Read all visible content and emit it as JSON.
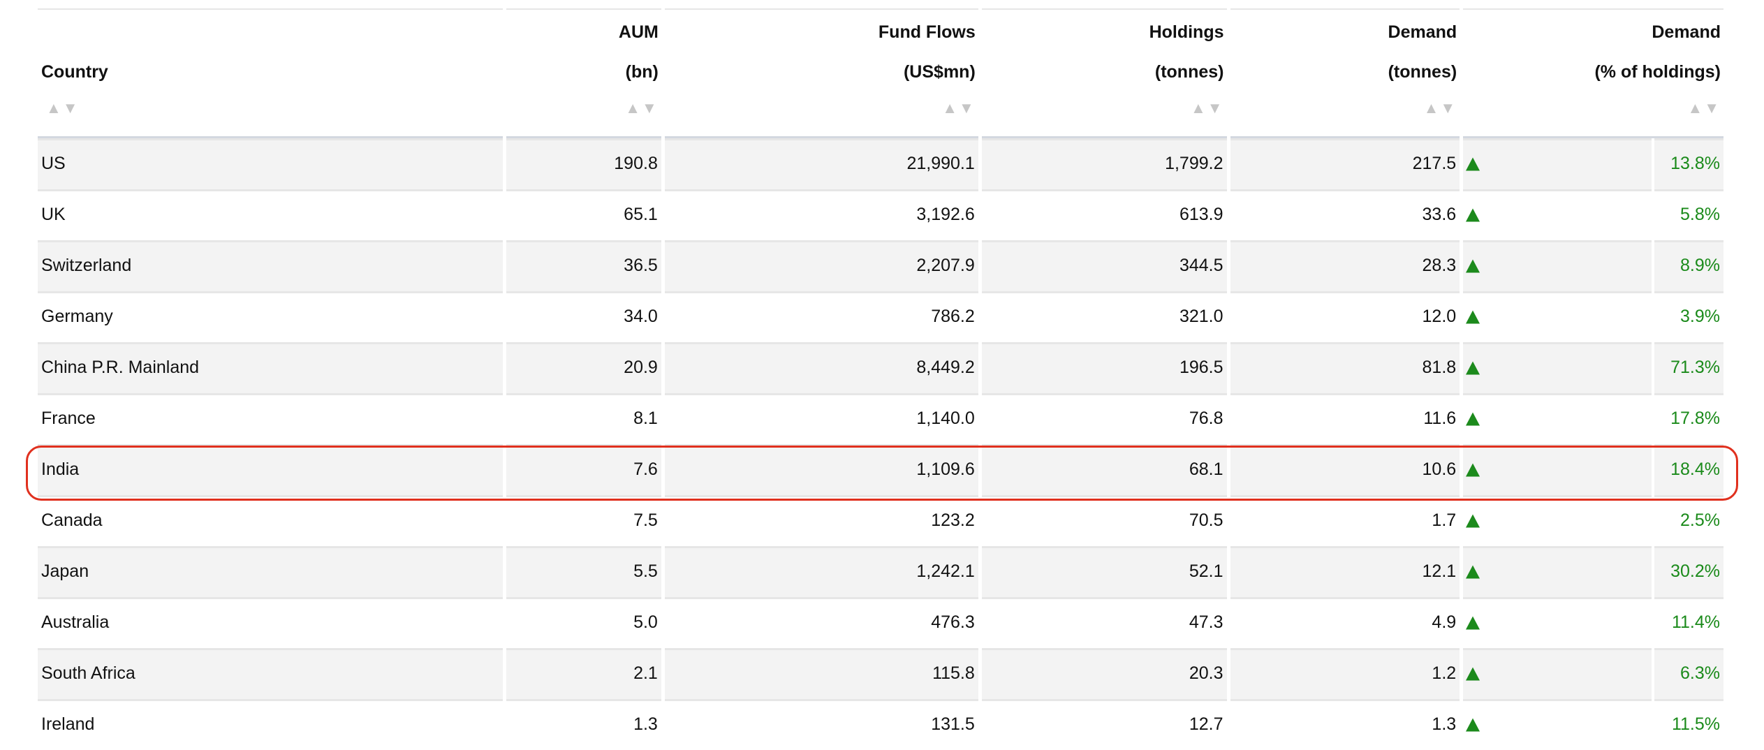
{
  "columns": {
    "country": {
      "line1": "",
      "line2": "Country"
    },
    "aum": {
      "line1": "AUM",
      "line2": "(bn)"
    },
    "flows": {
      "line1": "Fund Flows",
      "line2": "(US$mn)"
    },
    "holdings": {
      "line1": "Holdings",
      "line2": "(tonnes)"
    },
    "demand": {
      "line1": "Demand",
      "line2": "(tonnes)"
    },
    "demand_pct": {
      "line1": "Demand",
      "line2": "(% of holdings)"
    }
  },
  "sort_icon": "▲▼",
  "rows": [
    {
      "country": "US",
      "aum": "190.8",
      "flows": "21,990.1",
      "holdings": "1,799.2",
      "demand": "217.5",
      "demand_pct": "13.8%"
    },
    {
      "country": "UK",
      "aum": "65.1",
      "flows": "3,192.6",
      "holdings": "613.9",
      "demand": "33.6",
      "demand_pct": "5.8%"
    },
    {
      "country": "Switzerland",
      "aum": "36.5",
      "flows": "2,207.9",
      "holdings": "344.5",
      "demand": "28.3",
      "demand_pct": "8.9%"
    },
    {
      "country": "Germany",
      "aum": "34.0",
      "flows": "786.2",
      "holdings": "321.0",
      "demand": "12.0",
      "demand_pct": "3.9%"
    },
    {
      "country": "China P.R. Mainland",
      "aum": "20.9",
      "flows": "8,449.2",
      "holdings": "196.5",
      "demand": "81.8",
      "demand_pct": "71.3%"
    },
    {
      "country": "France",
      "aum": "8.1",
      "flows": "1,140.0",
      "holdings": "76.8",
      "demand": "11.6",
      "demand_pct": "17.8%"
    },
    {
      "country": "India",
      "aum": "7.6",
      "flows": "1,109.6",
      "holdings": "68.1",
      "demand": "10.6",
      "demand_pct": "18.4%"
    },
    {
      "country": "Canada",
      "aum": "7.5",
      "flows": "123.2",
      "holdings": "70.5",
      "demand": "1.7",
      "demand_pct": "2.5%"
    },
    {
      "country": "Japan",
      "aum": "5.5",
      "flows": "1,242.1",
      "holdings": "52.1",
      "demand": "12.1",
      "demand_pct": "30.2%"
    },
    {
      "country": "Australia",
      "aum": "5.0",
      "flows": "476.3",
      "holdings": "47.3",
      "demand": "4.9",
      "demand_pct": "11.4%"
    },
    {
      "country": "South Africa",
      "aum": "2.1",
      "flows": "115.8",
      "holdings": "20.3",
      "demand": "1.2",
      "demand_pct": "6.3%"
    },
    {
      "country": "Ireland",
      "aum": "1.3",
      "flows": "131.5",
      "holdings": "12.7",
      "demand": "1.3",
      "demand_pct": "11.5%"
    }
  ],
  "highlighted_country": "India",
  "colors": {
    "positive": "#1a8a1a",
    "highlight_border": "#e0301e",
    "stripe": "#f3f3f3"
  }
}
